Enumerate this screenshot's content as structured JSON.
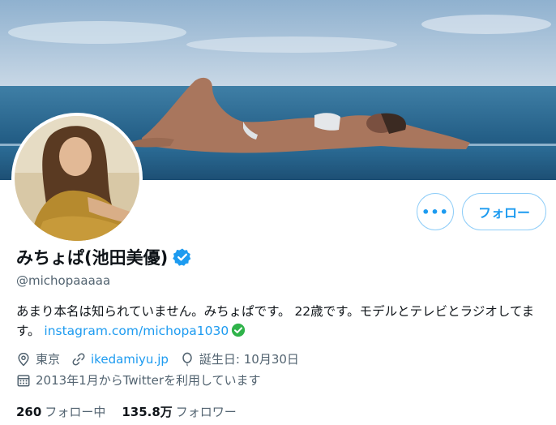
{
  "profile": {
    "display_name": "みちょぱ(池田美優)",
    "handle": "@michopaaaaa",
    "verified": true,
    "bio_text": "あまり本名は知られていません。みちょぱです。 22歳です。モデルとテレビとラジオしてます。",
    "bio_link": "instagram.com/michopa1030",
    "location": "東京",
    "website": "ikedamiyu.jp",
    "birthday": "誕生日: 10月30日",
    "joined": "2013年1月からTwitterを利用しています"
  },
  "actions": {
    "more_label": "•••",
    "follow_label": "フォロー"
  },
  "stats": {
    "following_count": "260",
    "following_label": "フォロー中",
    "followers_count": "135.8万",
    "followers_label": "フォロワー"
  },
  "icons": {
    "verified": "verified-badge-icon",
    "location": "location-pin-icon",
    "website": "link-icon",
    "birthday": "balloon-icon",
    "joined": "calendar-icon",
    "bio_check": "green-check-icon"
  },
  "colors": {
    "accent": "#1d9bf0",
    "secondary_text": "#536471",
    "check_green": "#2fb34a"
  }
}
